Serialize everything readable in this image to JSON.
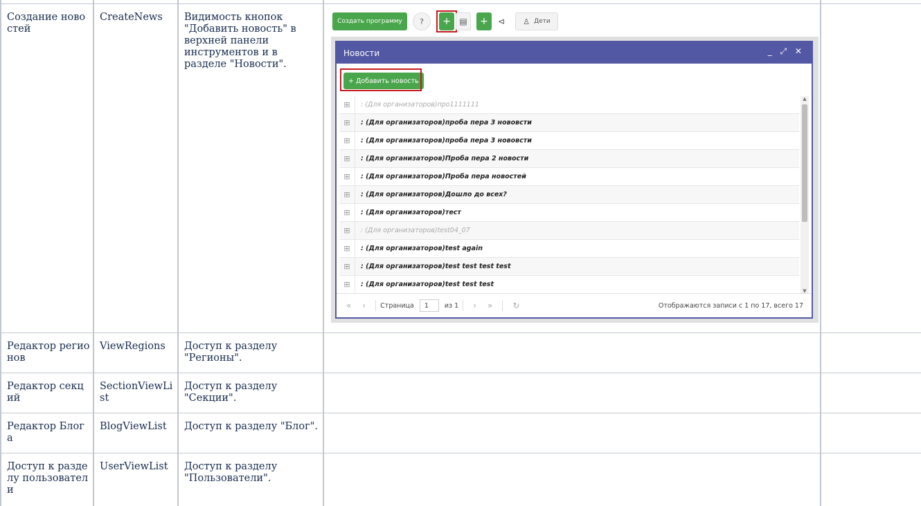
{
  "rows": [
    {
      "name": "Создание новостей",
      "code": "CreateNews",
      "desc": "Видимость кнопок \"Добавить новость\" в верхней панели инструментов и в разделе \"Новости\"."
    },
    {
      "name": "Редактор регионов",
      "code": "ViewRegions",
      "desc": "Доступ к разделу \"Регионы\"."
    },
    {
      "name": "Редактор секций",
      "code": "SectionViewList",
      "desc": "Доступ к разделу \"Секции\"."
    },
    {
      "name": "Редактор Блога",
      "code": "BlogViewList",
      "desc": "Доступ к разделу \"Блог\"."
    },
    {
      "name": "Доступ к разделу пользователи",
      "code": "UserViewList",
      "desc": "Доступ к разделу \"Пользователи\"."
    }
  ],
  "screenshot": {
    "toolbar": {
      "create_program": "Создать программу",
      "help_icon": "?",
      "add_icon": "+",
      "news_icon": "▤",
      "add2_icon": "+",
      "announce_icon": "⊲",
      "children_label": "Дети"
    },
    "window": {
      "title": "Новости",
      "controls": "_ ⤢ ✕",
      "add_button": "+ Добавить новость",
      "items": [
        {
          "text": ": (Для организаторов)про1111111",
          "dim": true
        },
        {
          "text": ": (Для организаторов)проба пера 3 нововсти",
          "dim": false
        },
        {
          "text": ": (Для организаторов)проба пера 3 нововсти",
          "dim": false
        },
        {
          "text": ": (Для организаторов)Проба пера 2 новости",
          "dim": false
        },
        {
          "text": ": (Для организаторов)Проба пера новостей",
          "dim": false
        },
        {
          "text": ": (Для организаторов)Дошло до всех?",
          "dim": false
        },
        {
          "text": ": (Для организаторов)тест",
          "dim": false
        },
        {
          "text": ": (Для организаторов)test04_07",
          "dim": true
        },
        {
          "text": ": (Для организаторов)test again",
          "dim": false
        },
        {
          "text": ": (Для организаторов)test test test test",
          "dim": false
        },
        {
          "text": ": (Для организаторов)test test test",
          "dim": false
        }
      ],
      "pager": {
        "first": "«",
        "prev": "‹",
        "page_label": "Страница",
        "page_value": "1",
        "of_label": "из 1",
        "next": "›",
        "last": "»",
        "refresh": "↻",
        "info": "Отображаются записи с 1 по 17, всего 17"
      }
    }
  }
}
